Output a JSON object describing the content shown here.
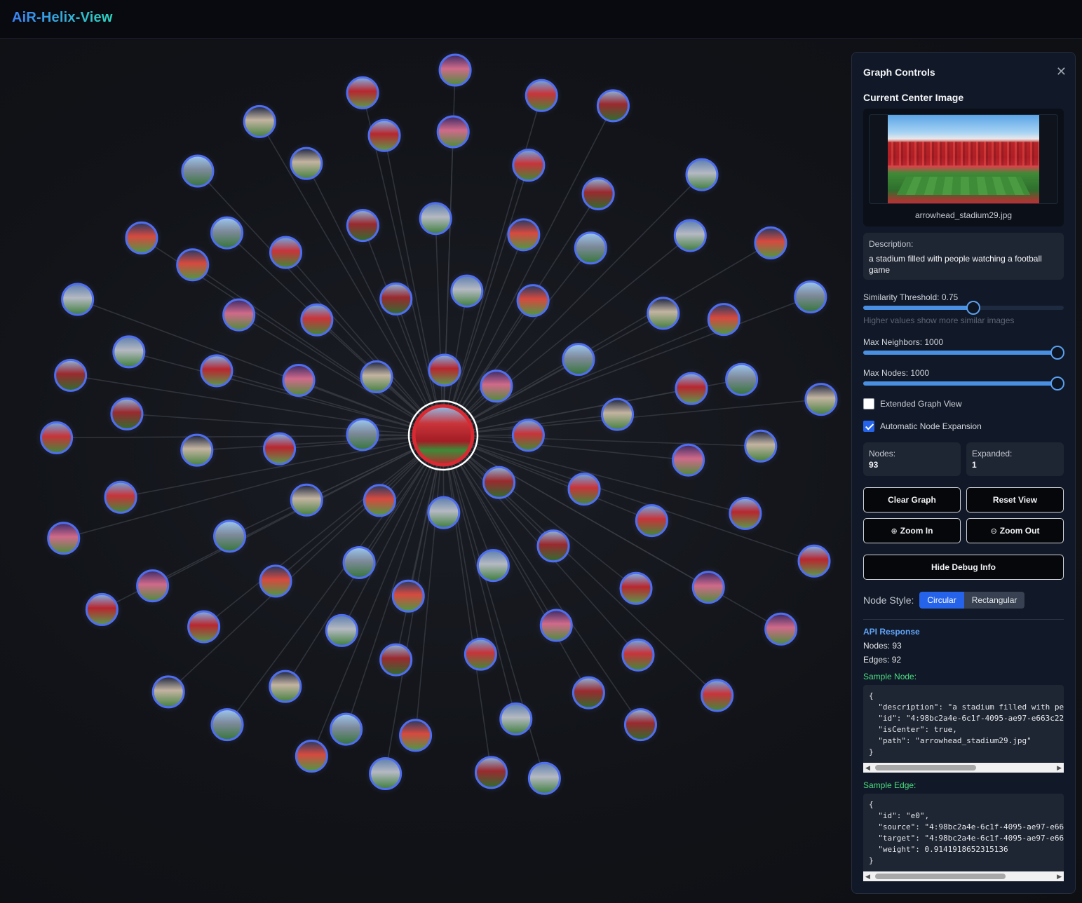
{
  "app": {
    "title": "AiR-Helix-View"
  },
  "graph": {
    "node_count": 93,
    "center_image": "arrowhead_stadium29.jpg",
    "colors": {
      "center_ring": "#d92a33",
      "node_ring": "#4f6ef0",
      "edge": "#3a3d44"
    }
  },
  "panel": {
    "title": "Graph Controls",
    "close_icon": "close-icon",
    "current_center_title": "Current Center Image",
    "image_filename": "arrowhead_stadium29.jpg",
    "description_label": "Description:",
    "description_text": "a stadium filled with people watching a football game",
    "similarity": {
      "label": "Similarity Threshold: 0.75",
      "value": 0.75,
      "hint": "Higher values show more similar images"
    },
    "max_neighbors": {
      "label": "Max Neighbors: 1000",
      "value": 1000
    },
    "max_nodes": {
      "label": "Max Nodes: 1000",
      "value": 1000
    },
    "extended_view": {
      "label": "Extended Graph View",
      "checked": false
    },
    "auto_expand": {
      "label": "Automatic Node Expansion",
      "checked": true
    },
    "stats": {
      "nodes_label": "Nodes:",
      "nodes_value": "93",
      "expanded_label": "Expanded:",
      "expanded_value": "1"
    },
    "buttons": {
      "clear": "Clear Graph",
      "reset": "Reset View",
      "zoom_in": "Zoom In",
      "zoom_out": "Zoom Out",
      "debug": "Hide Debug Info"
    },
    "node_style": {
      "label": "Node Style:",
      "options": [
        "Circular",
        "Rectangular"
      ],
      "selected": "Circular"
    },
    "api": {
      "title": "API Response",
      "nodes_line": "Nodes: 93",
      "edges_line": "Edges: 92",
      "sample_node_title": "Sample Node:",
      "sample_node_code": "{\n  \"description\": \"a stadium filled with pe\n  \"id\": \"4:98bc2a4e-6c1f-4095-ae97-e663c22\n  \"isCenter\": true,\n  \"path\": \"arrowhead_stadium29.jpg\"\n}",
      "sample_edge_title": "Sample Edge:",
      "sample_edge_code": "{\n  \"id\": \"e0\",\n  \"source\": \"4:98bc2a4e-6c1f-4095-ae97-e66\n  \"target\": \"4:98bc2a4e-6c1f-4095-ae97-e66\n  \"weight\": 0.9141918652315136\n}"
    }
  }
}
